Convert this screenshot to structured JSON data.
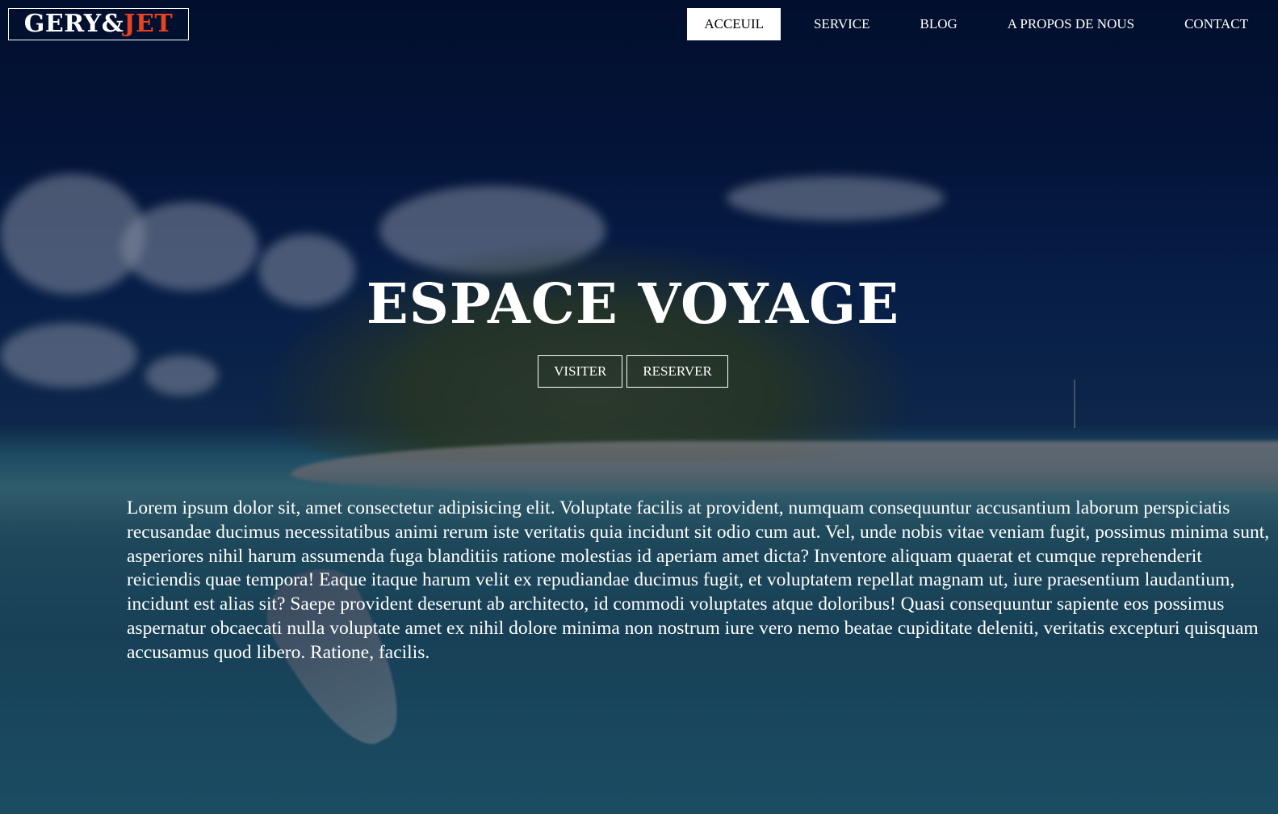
{
  "header": {
    "logo": {
      "part1": "GERY&",
      "part2": "JET"
    },
    "nav": [
      {
        "label": "ACCEUIL",
        "active": true
      },
      {
        "label": "SERVICE",
        "active": false
      },
      {
        "label": "BLOG",
        "active": false
      },
      {
        "label": "A PROPOS DE NOUS",
        "active": false
      },
      {
        "label": "CONTACT",
        "active": false
      }
    ]
  },
  "hero": {
    "title": "ESPACE VOYAGE",
    "buttons": {
      "visit": "VISITER",
      "reserve": "RESERVER"
    },
    "body": "Lorem ipsum dolor sit, amet consectetur adipisicing elit. Voluptate facilis at provident, numquam consequuntur accusantium laborum perspiciatis recusandae ducimus necessitatibus animi rerum iste veritatis quia incidunt sit odio cum aut. Vel, unde nobis vitae veniam fugit, possimus minima sunt, asperiores nihil harum assumenda fuga blanditiis ratione molestias id aperiam amet dicta? Inventore aliquam quaerat et cumque reprehenderit reiciendis quae tempora! Eaque itaque harum velit ex repudiandae ducimus fugit, et voluptatem repellat magnam ut, iure praesentium laudantium, incidunt est alias sit? Saepe provident deserunt ab architecto, id commodi voluptates atque doloribus! Quasi consequuntur sapiente eos possimus aspernatur obcaecati nulla voluptate amet ex nihil dolore minima non nostrum iure vero nemo beatae cupiditate deleniti, veritatis excepturi quisquam accusamus quod libero. Ratione, facilis."
  },
  "colors": {
    "accent": "#e8421f",
    "text": "#ffffff",
    "sky": "#041233",
    "water": "#2a7186"
  }
}
